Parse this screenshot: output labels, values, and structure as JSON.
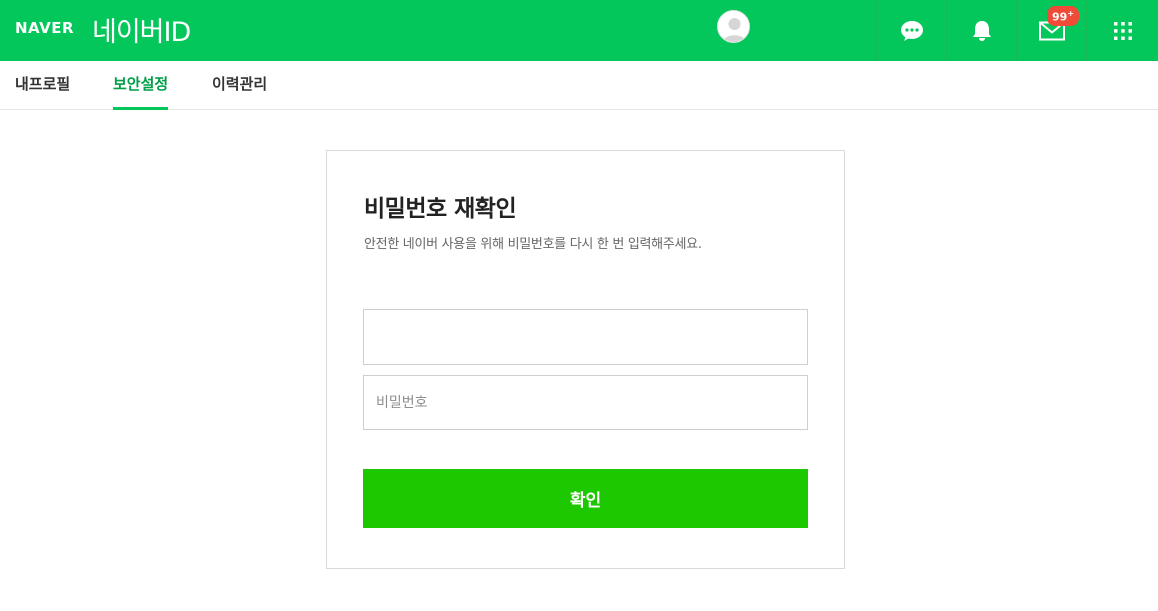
{
  "header": {
    "brand": "NAVER",
    "title": "네이버ID",
    "brand_color": "#03c75a",
    "icons": {
      "chat": "chat-bubble-icon",
      "notification": "bell-icon",
      "mail": "mail-icon",
      "apps": "grid-icon"
    },
    "mail_badge": "99",
    "mail_badge_plus": "+"
  },
  "tabs": [
    {
      "label": "내프로필",
      "active": false
    },
    {
      "label": "보안설정",
      "active": true
    },
    {
      "label": "이력관리",
      "active": false
    }
  ],
  "card": {
    "title": "비밀번호 재확인",
    "description": "안전한 네이버 사용을 위해 비밀번호를 다시 한 번 입력해주세요.",
    "id_value": "",
    "password_placeholder": "비밀번호",
    "confirm_label": "확인",
    "button_color": "#1ec800"
  }
}
